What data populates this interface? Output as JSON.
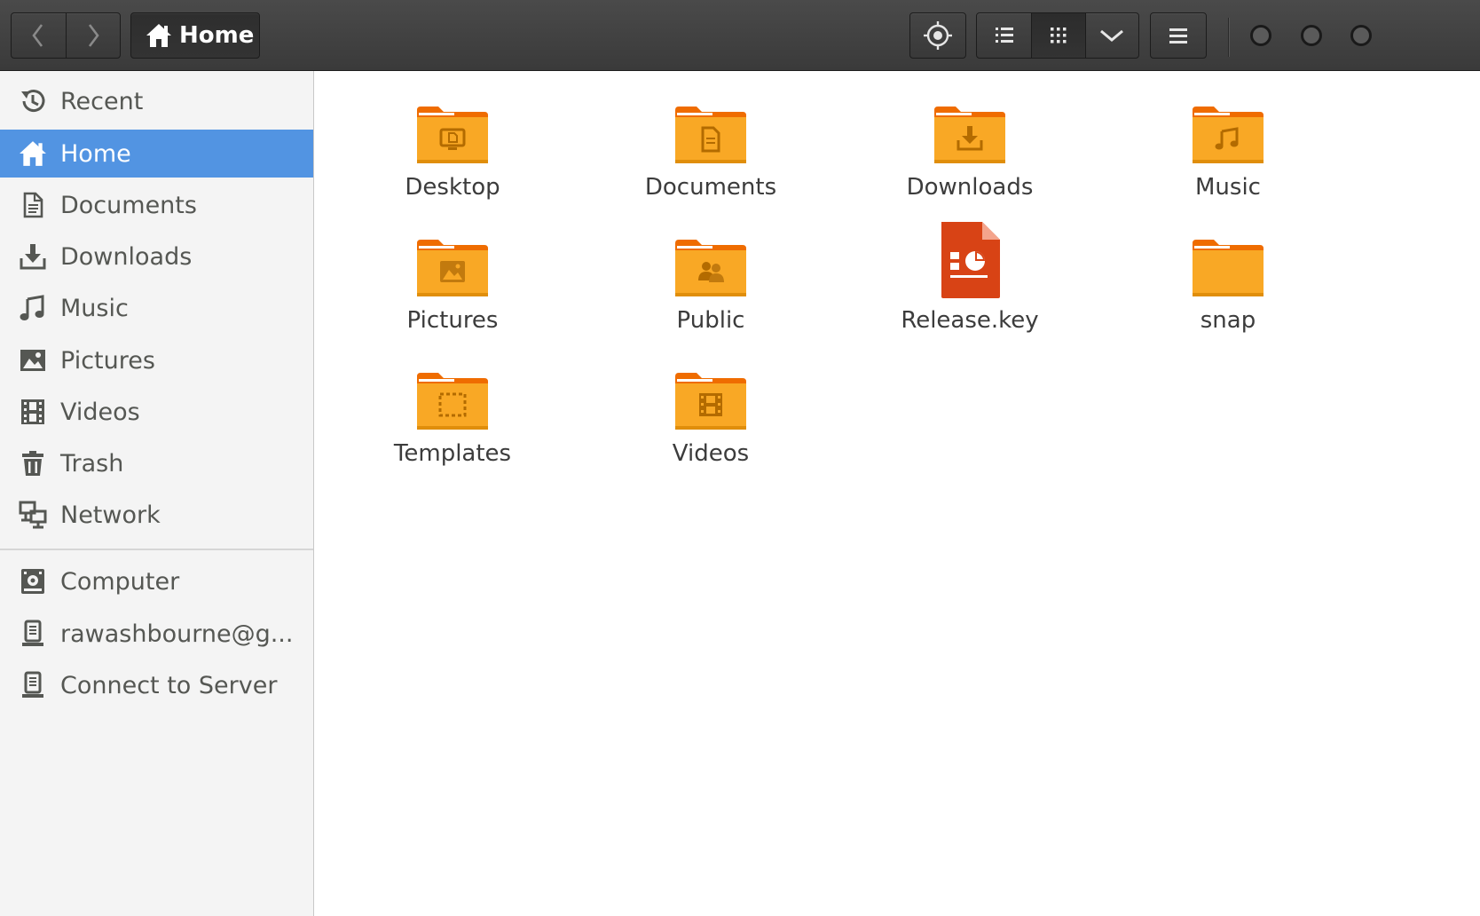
{
  "colors": {
    "headerbar": "#3d3d3d",
    "selection": "#5294e2",
    "folder_orange": "#f9a825",
    "folder_tab": "#ef6c00",
    "keynote_red": "#d84315",
    "sidebar_bg": "#f4f4f4",
    "text": "#3c3c3c"
  },
  "headerbar": {
    "back_icon": "chevron-left-icon",
    "forward_icon": "chevron-right-icon",
    "path_label": "Home",
    "path_icon": "home-icon",
    "locate_icon": "crosshair-icon",
    "list_view_icon": "list-view-icon",
    "grid_view_icon": "grid-view-icon",
    "view_options_icon": "chevron-down-icon",
    "menu_icon": "hamburger-menu-icon",
    "window_controls": [
      "minimize",
      "maximize",
      "close"
    ]
  },
  "sidebar": {
    "places": [
      {
        "label": "Recent",
        "icon": "clock-icon"
      },
      {
        "label": "Home",
        "icon": "home-icon",
        "selected": true
      },
      {
        "label": "Documents",
        "icon": "document-icon"
      },
      {
        "label": "Downloads",
        "icon": "download-icon"
      },
      {
        "label": "Music",
        "icon": "music-icon"
      },
      {
        "label": "Pictures",
        "icon": "picture-icon"
      },
      {
        "label": "Videos",
        "icon": "film-icon"
      },
      {
        "label": "Trash",
        "icon": "trash-icon"
      },
      {
        "label": "Network",
        "icon": "network-icon"
      }
    ],
    "devices": [
      {
        "label": "Computer",
        "icon": "computer-icon"
      },
      {
        "label": "rawashbourne@g...",
        "icon": "server-icon"
      },
      {
        "label": "Connect to Server",
        "icon": "server-icon"
      }
    ]
  },
  "files": [
    {
      "name": "Desktop",
      "type": "folder",
      "emblem": "desktop"
    },
    {
      "name": "Documents",
      "type": "folder",
      "emblem": "document"
    },
    {
      "name": "Downloads",
      "type": "folder",
      "emblem": "download"
    },
    {
      "name": "Music",
      "type": "folder",
      "emblem": "music"
    },
    {
      "name": "Pictures",
      "type": "folder",
      "emblem": "picture"
    },
    {
      "name": "Public",
      "type": "folder",
      "emblem": "people"
    },
    {
      "name": "Release.key",
      "type": "presentation",
      "emblem": "keynote"
    },
    {
      "name": "snap",
      "type": "folder",
      "emblem": "none"
    },
    {
      "name": "Templates",
      "type": "folder",
      "emblem": "template"
    },
    {
      "name": "Videos",
      "type": "folder",
      "emblem": "film"
    }
  ]
}
